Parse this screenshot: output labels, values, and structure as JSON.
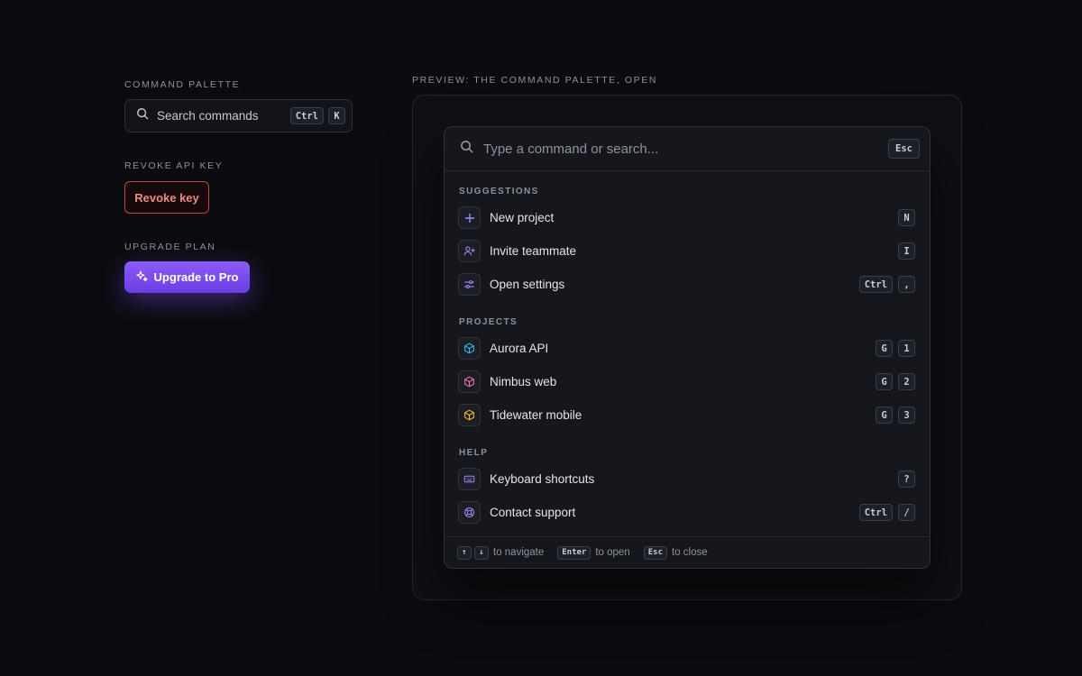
{
  "left": {
    "command_palette": {
      "section_label": "COMMAND PALETTE",
      "trigger_label": "Search commands",
      "shortcut": [
        "Ctrl",
        "K"
      ]
    },
    "revoke": {
      "section_label": "REVOKE API KEY",
      "button_label": "Revoke key"
    },
    "upgrade": {
      "section_label": "UPGRADE PLAN",
      "button_label": "Upgrade to Pro"
    }
  },
  "preview": {
    "label": "PREVIEW: THE COMMAND PALETTE, OPEN",
    "palette": {
      "search_placeholder": "Type a command or search...",
      "close_key": "Esc",
      "groups": [
        {
          "label": "SUGGESTIONS",
          "items": [
            {
              "name": "New project",
              "icon": "plus-icon",
              "keys": [
                "N"
              ]
            },
            {
              "name": "Invite teammate",
              "icon": "user-plus-icon",
              "keys": [
                "I"
              ]
            },
            {
              "name": "Open settings",
              "icon": "sliders-icon",
              "keys": [
                "Ctrl",
                ","
              ]
            }
          ]
        },
        {
          "label": "PROJECTS",
          "items": [
            {
              "name": "Aurora API",
              "icon": "cube-icon",
              "keys": [
                "G",
                "1"
              ]
            },
            {
              "name": "Nimbus web",
              "icon": "cube-icon",
              "keys": [
                "G",
                "2"
              ]
            },
            {
              "name": "Tidewater mobile",
              "icon": "cube-icon",
              "keys": [
                "G",
                "3"
              ]
            }
          ]
        },
        {
          "label": "HELP",
          "items": [
            {
              "name": "Keyboard shortcuts",
              "icon": "keyboard-icon",
              "keys": [
                "?"
              ]
            },
            {
              "name": "Contact support",
              "icon": "lifebuoy-icon",
              "keys": [
                "Ctrl",
                "/"
              ]
            }
          ]
        }
      ],
      "footer": {
        "navigate_keys": [
          "↑",
          "↓"
        ],
        "navigate_text": "to navigate",
        "open_key": "Enter",
        "open_text": "to open",
        "close_key": "Esc",
        "close_text": "to close"
      }
    }
  },
  "colors": {
    "accent": "#8b5cf6",
    "danger": "#c7423f",
    "aurora": "#38bdf8",
    "nimbus": "#f472b6",
    "tidewater": "#fbbf24"
  }
}
